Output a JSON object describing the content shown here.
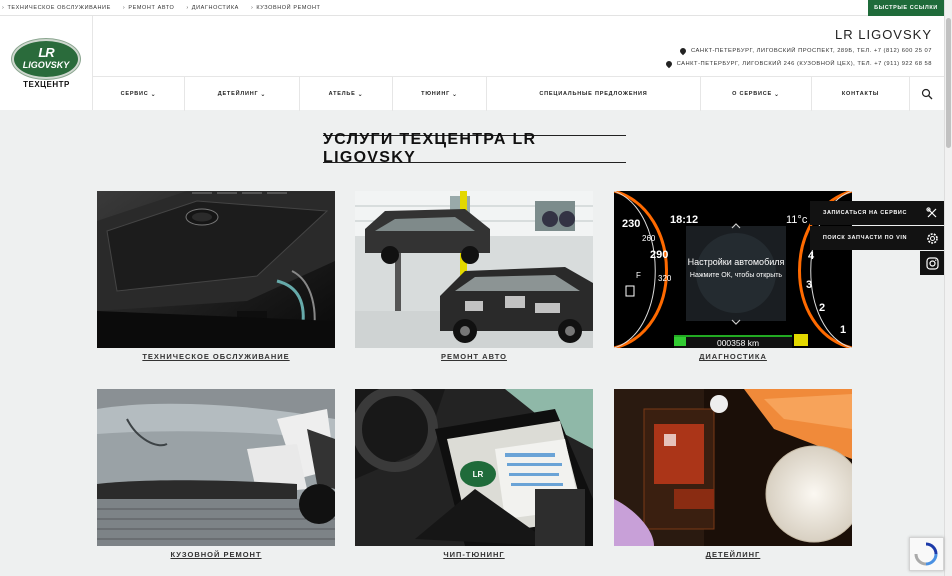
{
  "topbar": {
    "links": [
      "ТЕХНИЧЕСКОЕ ОБСЛУЖИВАНИЕ",
      "РЕМОНТ АВТО",
      "ДИАГНОСТИКА",
      "КУЗОВНОЙ РЕМОНТ"
    ],
    "quick_links": "БЫСТРЫЕ ССЫЛКИ"
  },
  "header": {
    "logo_lr": "LR",
    "logo_name": "LIGOVSKY",
    "logo_sub": "ТЕХЦЕНТР",
    "brand": "LR LIGOVSKY",
    "address1": "САНКТ-ПЕТЕРБУРГ, ЛИГОВСКИЙ ПРОСПЕКТ, 289Б, ТЕЛ. +7 (812) 600 25 07",
    "address2": "САНКТ-ПЕТЕРБУРГ, ЛИГОВСКИЙ 246 (КУЗОВНОЙ ЦЕХ), ТЕЛ. +7 (911) 922 68 58"
  },
  "nav": {
    "items": [
      "СЕРВИС",
      "ДЕТЕЙЛИНГ",
      "АТЕЛЬЕ",
      "ТЮНИНГ",
      "СПЕЦИАЛЬНЫЕ ПРЕДЛОЖЕНИЯ",
      "О СЕРВИСЕ",
      "КОНТАКТЫ"
    ]
  },
  "main": {
    "title": "УСЛУГИ ТЕХЦЕНТРА LR LIGOVSKY",
    "cards": [
      {
        "caption": "ТЕХНИЧЕСКОЕ ОБСЛУЖИВАНИЕ"
      },
      {
        "caption": "РЕМОНТ АВТО"
      },
      {
        "caption": "ДИАГНОСТИКА"
      },
      {
        "caption": "КУЗОВНОЙ РЕМОНТ"
      },
      {
        "caption": "ЧИП-ТЮНИНГ"
      },
      {
        "caption": "ДЕТЕЙЛИНГ"
      }
    ],
    "dash": {
      "speed": "230",
      "s260": "260",
      "s290": "290",
      "s320": "320",
      "time": "18:12",
      "temp": "11°c",
      "menu1": "Настройки автомобиля",
      "menu2": "Нажмите ОК, чтобы открыть",
      "odometer": "000358 km",
      "r4": "4",
      "r3": "3",
      "r2": "2",
      "r1": "1",
      "fuel": "F"
    }
  },
  "side": {
    "service": "ЗАПИСАТЬСЯ НА СЕРВИС",
    "vin": "ПОИСК ЗАПЧАСТИ ПО VIN"
  },
  "colors": {
    "brand_green": "#1f6b3a",
    "widget_black": "#121212"
  }
}
